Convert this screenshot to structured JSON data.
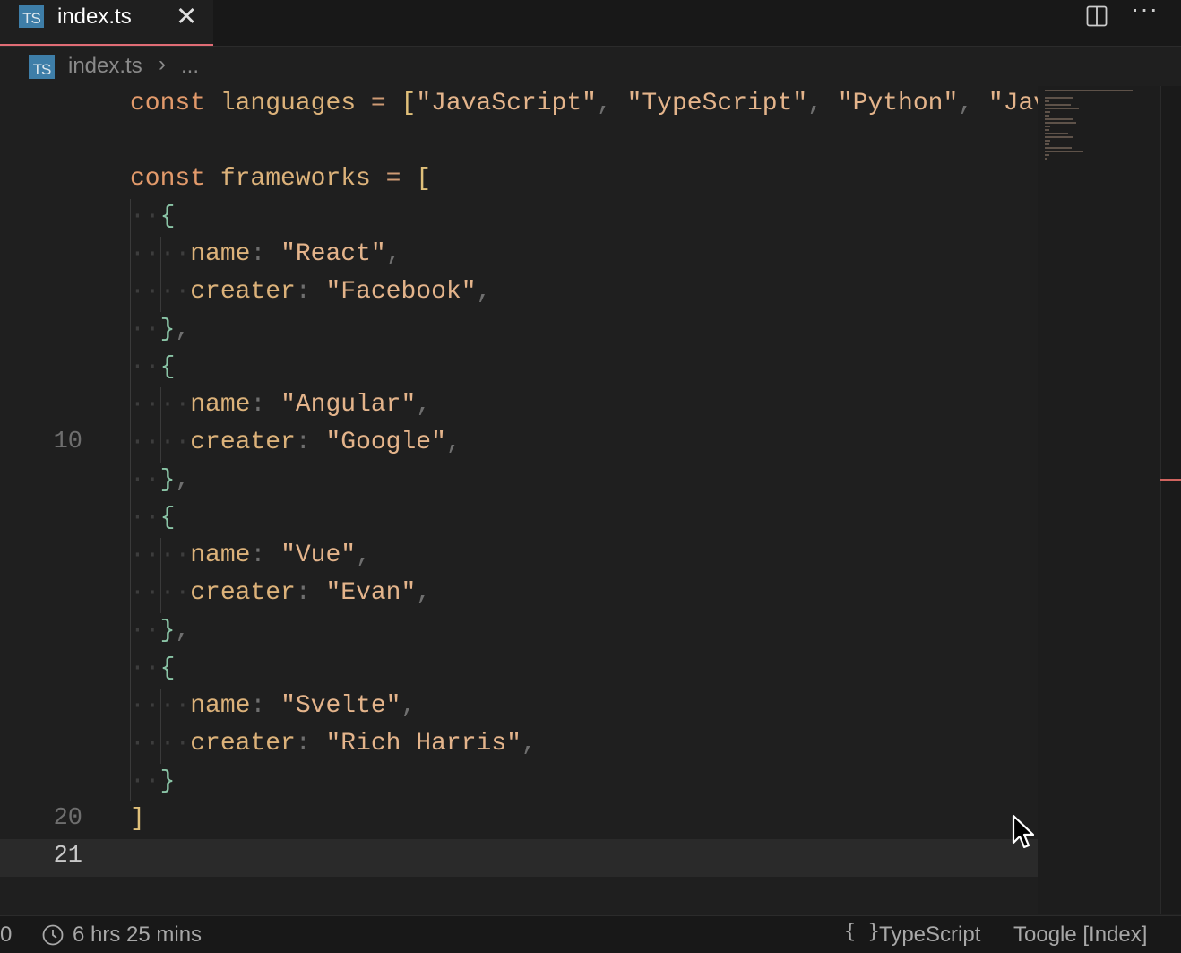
{
  "tab": {
    "badge": "TS",
    "title": "index.ts",
    "close": "✕"
  },
  "breadcrumb": {
    "badge": "TS",
    "file": "index.ts",
    "separator": "›",
    "more": "..."
  },
  "editor": {
    "lines": [
      {
        "n": "",
        "tokens": [
          [
            "kw",
            "const"
          ],
          [
            "plain",
            " "
          ],
          [
            "ident",
            "languages"
          ],
          [
            "plain",
            " "
          ],
          [
            "op",
            "="
          ],
          [
            "plain",
            " "
          ],
          [
            "bracket-y",
            "["
          ],
          [
            "str",
            "\"JavaScript\""
          ],
          [
            "punc",
            ","
          ],
          [
            "plain",
            " "
          ],
          [
            "str",
            "\"TypeScript\""
          ],
          [
            "punc",
            ","
          ],
          [
            "plain",
            " "
          ],
          [
            "str",
            "\"Python\""
          ],
          [
            "punc",
            ","
          ],
          [
            "plain",
            " "
          ],
          [
            "str",
            "\"Jav"
          ]
        ]
      },
      {
        "n": "",
        "tokens": []
      },
      {
        "n": "",
        "tokens": [
          [
            "kw",
            "const"
          ],
          [
            "plain",
            " "
          ],
          [
            "ident",
            "frameworks"
          ],
          [
            "plain",
            " "
          ],
          [
            "op",
            "="
          ],
          [
            "plain",
            " "
          ],
          [
            "bracket-y",
            "["
          ]
        ]
      },
      {
        "n": "",
        "tokens": [
          [
            "ws",
            "··"
          ],
          [
            "brk",
            "{"
          ]
        ]
      },
      {
        "n": "",
        "tokens": [
          [
            "ws",
            "····"
          ],
          [
            "ident",
            "name"
          ],
          [
            "punc",
            ":"
          ],
          [
            "plain",
            " "
          ],
          [
            "str",
            "\"React\""
          ],
          [
            "punc",
            ","
          ]
        ]
      },
      {
        "n": "",
        "tokens": [
          [
            "ws",
            "····"
          ],
          [
            "ident",
            "creater"
          ],
          [
            "punc",
            ":"
          ],
          [
            "plain",
            " "
          ],
          [
            "str",
            "\"Facebook\""
          ],
          [
            "punc",
            ","
          ]
        ]
      },
      {
        "n": "",
        "tokens": [
          [
            "ws",
            "··"
          ],
          [
            "brk",
            "}"
          ],
          [
            "punc",
            ","
          ]
        ]
      },
      {
        "n": "",
        "tokens": [
          [
            "ws",
            "··"
          ],
          [
            "brk",
            "{"
          ]
        ]
      },
      {
        "n": "",
        "tokens": [
          [
            "ws",
            "····"
          ],
          [
            "ident",
            "name"
          ],
          [
            "punc",
            ":"
          ],
          [
            "plain",
            " "
          ],
          [
            "str",
            "\"Angular\""
          ],
          [
            "punc",
            ","
          ]
        ]
      },
      {
        "n": "10",
        "tokens": [
          [
            "ws",
            "····"
          ],
          [
            "ident",
            "creater"
          ],
          [
            "punc",
            ":"
          ],
          [
            "plain",
            " "
          ],
          [
            "str",
            "\"Google\""
          ],
          [
            "punc",
            ","
          ]
        ]
      },
      {
        "n": "",
        "tokens": [
          [
            "ws",
            "··"
          ],
          [
            "brk",
            "}"
          ],
          [
            "punc",
            ","
          ]
        ]
      },
      {
        "n": "",
        "tokens": [
          [
            "ws",
            "··"
          ],
          [
            "brk",
            "{"
          ]
        ]
      },
      {
        "n": "",
        "tokens": [
          [
            "ws",
            "····"
          ],
          [
            "ident",
            "name"
          ],
          [
            "punc",
            ":"
          ],
          [
            "plain",
            " "
          ],
          [
            "str",
            "\"Vue\""
          ],
          [
            "punc",
            ","
          ]
        ]
      },
      {
        "n": "",
        "tokens": [
          [
            "ws",
            "····"
          ],
          [
            "ident",
            "creater"
          ],
          [
            "punc",
            ":"
          ],
          [
            "plain",
            " "
          ],
          [
            "str",
            "\"Evan\""
          ],
          [
            "punc",
            ","
          ]
        ]
      },
      {
        "n": "",
        "tokens": [
          [
            "ws",
            "··"
          ],
          [
            "brk",
            "}"
          ],
          [
            "punc",
            ","
          ]
        ]
      },
      {
        "n": "",
        "tokens": [
          [
            "ws",
            "··"
          ],
          [
            "brk",
            "{"
          ]
        ]
      },
      {
        "n": "",
        "tokens": [
          [
            "ws",
            "····"
          ],
          [
            "ident",
            "name"
          ],
          [
            "punc",
            ":"
          ],
          [
            "plain",
            " "
          ],
          [
            "str",
            "\"Svelte\""
          ],
          [
            "punc",
            ","
          ]
        ]
      },
      {
        "n": "",
        "tokens": [
          [
            "ws",
            "····"
          ],
          [
            "ident",
            "creater"
          ],
          [
            "punc",
            ":"
          ],
          [
            "plain",
            " "
          ],
          [
            "str",
            "\"Rich Harris\""
          ],
          [
            "punc",
            ","
          ]
        ]
      },
      {
        "n": "",
        "tokens": [
          [
            "ws",
            "··"
          ],
          [
            "brk",
            "}"
          ]
        ]
      },
      {
        "n": "20",
        "tokens": [
          [
            "bracket-y",
            "]"
          ]
        ]
      },
      {
        "n": "21",
        "tokens": [],
        "current": true
      }
    ]
  },
  "statusbar": {
    "left_count": "0",
    "time": "6 hrs 25 mins",
    "language_icon": "{ }",
    "language": "TypeScript",
    "toggle": "Toogle [Index]"
  },
  "icons": {
    "split": "split-editor-icon",
    "more": "more-actions-icon",
    "clock": "clock-icon",
    "cursor": "mouse-cursor-icon"
  },
  "colors": {
    "accent": "#e06c75",
    "ts_badge": "#3e7ea8",
    "editor_bg": "#1f1f1f"
  }
}
